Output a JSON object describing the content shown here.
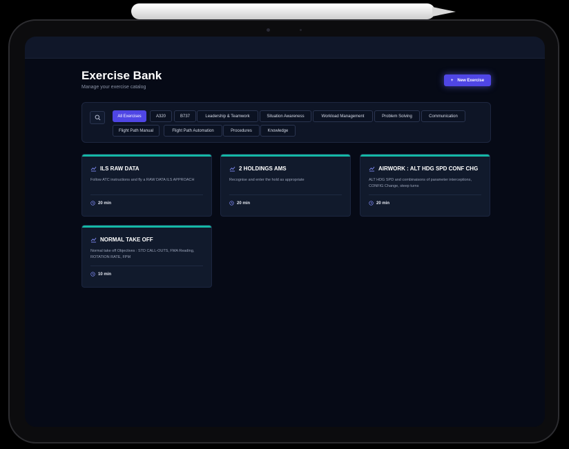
{
  "header": {
    "title": "Exercise Bank",
    "subtitle": "Manage your exercise catalog",
    "new_button_label": "New Exercise",
    "new_button_icon": "+"
  },
  "filters": {
    "chips": [
      {
        "label": "All Exercises",
        "active": true
      },
      {
        "label": "A320",
        "active": false
      },
      {
        "label": "B737",
        "active": false
      },
      {
        "label": "Leadership & Teamwork",
        "active": false
      },
      {
        "label": "Situation Awareness",
        "active": false
      },
      {
        "label": "Workload Management",
        "active": false
      },
      {
        "label": "Problem Solving",
        "active": false
      },
      {
        "label": "Communication",
        "active": false
      },
      {
        "label": "Flight Path Manual",
        "active": false
      },
      {
        "label": "Flight Path Automation",
        "active": false
      },
      {
        "label": "Procedures",
        "active": false
      },
      {
        "label": "Knowledge",
        "active": false
      }
    ]
  },
  "cards": [
    {
      "title": "ILS RAW DATA",
      "description": "Follow ATC instructions and fly a RAW DATA ILS APPROACH",
      "duration": "20 min"
    },
    {
      "title": "2 HOLDINGS AMS",
      "description": "Recognise and enter the hold as appropriate",
      "duration": "20 min"
    },
    {
      "title": "AIRWORK : ALT HDG SPD CONF CHG",
      "description": "ALT HDG SPD and combinaisons of parameter interceptions, CONFIG Change, steep turns",
      "duration": "20 min"
    },
    {
      "title": "NORMAL TAKE OFF",
      "description": "Normal take off Objectives : STD CALL-OUTS, FMA Reading, ROTATION RATE, FPM",
      "duration": "10 min"
    }
  ],
  "colors": {
    "accent": "#4f46e5",
    "card_bar": "#14b8a6",
    "background": "#060a16",
    "icon_accent": "#818cf8"
  }
}
